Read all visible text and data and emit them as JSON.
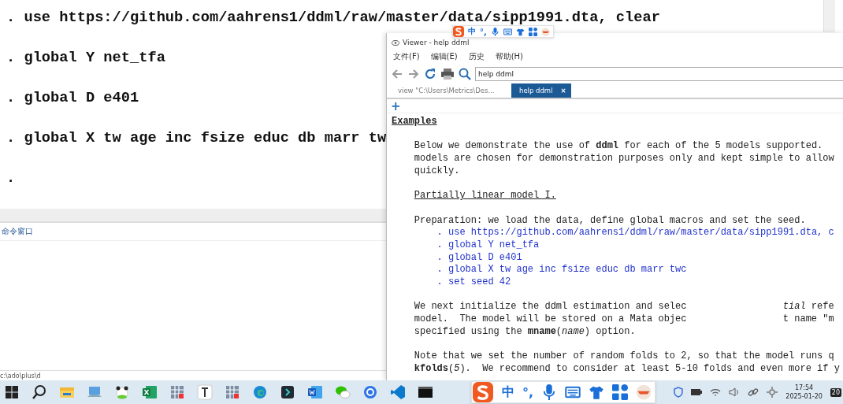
{
  "results_window": {
    "lines": [
      ". use https://github.com/aahrens1/ddml/raw/master/data/sipp1991.dta, clear",
      ". global Y net_tfa",
      ". global D e401",
      ". global X tw age inc fsize educ db marr tw",
      "."
    ]
  },
  "command_window": {
    "title": "命令窗口"
  },
  "status_bar": {
    "path": "c:\\ado\\plus\\d"
  },
  "viewer": {
    "title": "Viewer - help ddml",
    "menu": [
      "文件(F)",
      "编辑(E)",
      "历史",
      "帮助(H)"
    ],
    "address": "help ddml",
    "tabs": [
      {
        "label": "view \"C:\\Users\\Metrics\\Des...",
        "selected": false
      },
      {
        "label": "help ddml",
        "selected": true,
        "close": "×"
      }
    ],
    "new_tab": "+",
    "content": [
      {
        "kind": "heading",
        "lines": [
          [
            "Examples"
          ]
        ]
      },
      {
        "kind": "para",
        "lines": [
          [
            "Below we demonstrate the use of **ddml** for each of the 5 models supported."
          ],
          [
            "models are chosen for demonstration purposes only and kept simple to allow"
          ],
          [
            "quickly."
          ]
        ]
      },
      {
        "kind": "subheading",
        "lines": [
          [
            "Partially linear model I."
          ]
        ]
      },
      {
        "kind": "para",
        "lines": [
          [
            "Preparation: we load the data, define global macros and set the seed."
          ]
        ]
      },
      {
        "kind": "code",
        "lines": [
          [
            ". use https://github.com/aahrens1/ddml/raw/master/data/sipp1991.dta, c"
          ],
          [
            ". global Y net_tfa"
          ],
          [
            ". global D e401"
          ],
          [
            ". global X tw age inc fsize educ db marr twc"
          ],
          [
            ". set seed 42"
          ]
        ]
      },
      {
        "kind": "para",
        "lines": [
          [
            "We next initialize the ddml estimation and selec",
            "*tial* refe"
          ],
          [
            "model.  The model will be stored on a Mata objec",
            "t name \"m"
          ],
          [
            "specified using the **mname**(*name*) option."
          ]
        ]
      },
      {
        "kind": "para",
        "lines": [
          [
            "Note that we set the number of random folds to 2, so that the model runs q"
          ],
          [
            "**kfolds**(*5*).  We recommend to consider at least 5-10 folds and even more if y"
          ]
        ]
      }
    ]
  },
  "ime_toolbars": [
    {
      "lang": "中",
      "punct": "°,"
    },
    {
      "lang": "中",
      "punct": "°,"
    }
  ],
  "taskbar": {
    "apps": [
      {
        "kind": "start"
      },
      {
        "kind": "search"
      },
      {
        "kind": "folder"
      },
      {
        "kind": "computer"
      },
      {
        "kind": "panda"
      },
      {
        "kind": "excel"
      },
      {
        "kind": "grid"
      },
      {
        "kind": "text"
      },
      {
        "kind": "grid"
      },
      {
        "kind": "edge"
      },
      {
        "kind": "terminal"
      },
      {
        "kind": "word"
      },
      {
        "kind": "chat"
      },
      {
        "kind": "circle"
      },
      {
        "kind": "vscode"
      },
      {
        "kind": "console"
      }
    ],
    "time": "17:54",
    "date": "2025-01-20",
    "notifications": "20"
  }
}
